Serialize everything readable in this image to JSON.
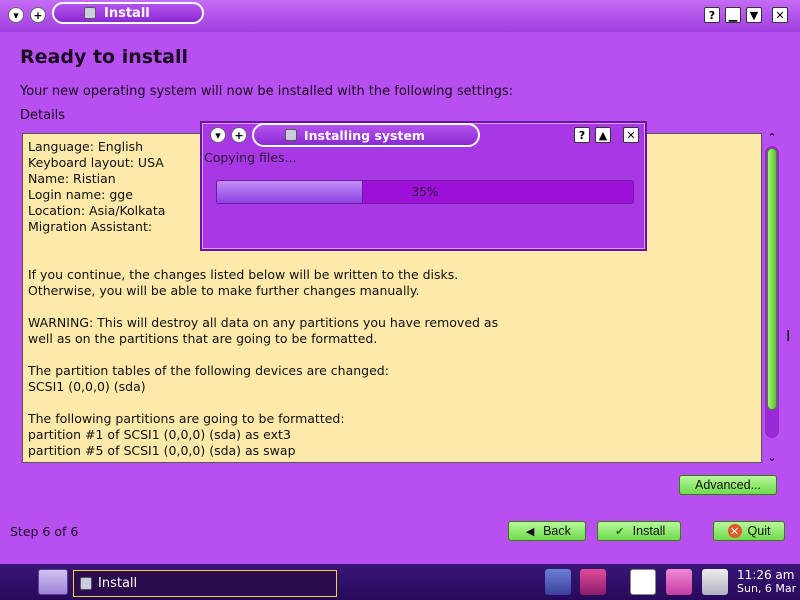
{
  "window": {
    "title": "Install",
    "controls": [
      "?",
      "_",
      "▼",
      "✕"
    ]
  },
  "installer": {
    "heading": "Ready to install",
    "subtitle": "Your new operating system will now be installed with the following settings:",
    "details_label": "Details",
    "details_text": "Language: English\nKeyboard layout: USA\nName: Ristian\nLogin name: gge\nLocation: Asia/Kolkata\nMigration Assistant:\n\n\nIf you continue, the changes listed below will be written to the disks.\nOtherwise, you will be able to make further changes manually.\n\nWARNING: This will destroy all data on any partitions you have removed as\nwell as on the partitions that are going to be formatted.\n\nThe partition tables of the following devices are changed:\nSCSI1 (0,0,0) (sda)\n\nThe following partitions are going to be formatted:\npartition #1 of SCSI1 (0,0,0) (sda) as ext3\npartition #5 of SCSI1 (0,0,0) (sda) as swap",
    "scroll_fraction": 0.0,
    "step_label": "Step 6 of 6",
    "buttons": {
      "advanced": "Advanced...",
      "back": "Back",
      "install": "Install",
      "quit": "Quit"
    }
  },
  "progress_dialog": {
    "title": "Installing system",
    "status": "Copying files...",
    "percent_label": "35%",
    "percent_value": 35
  },
  "taskbar": {
    "task_label": "Install",
    "clock_time": "11:26 am",
    "clock_date": "Sun, 6 Mar",
    "start_label": "Home"
  },
  "colors": {
    "background": "#b84ff0",
    "accent_green": "#6fdb4c",
    "details_bg": "#fde9a9",
    "progress_fill": "#8e43e4",
    "taskbar": "#26095a"
  }
}
